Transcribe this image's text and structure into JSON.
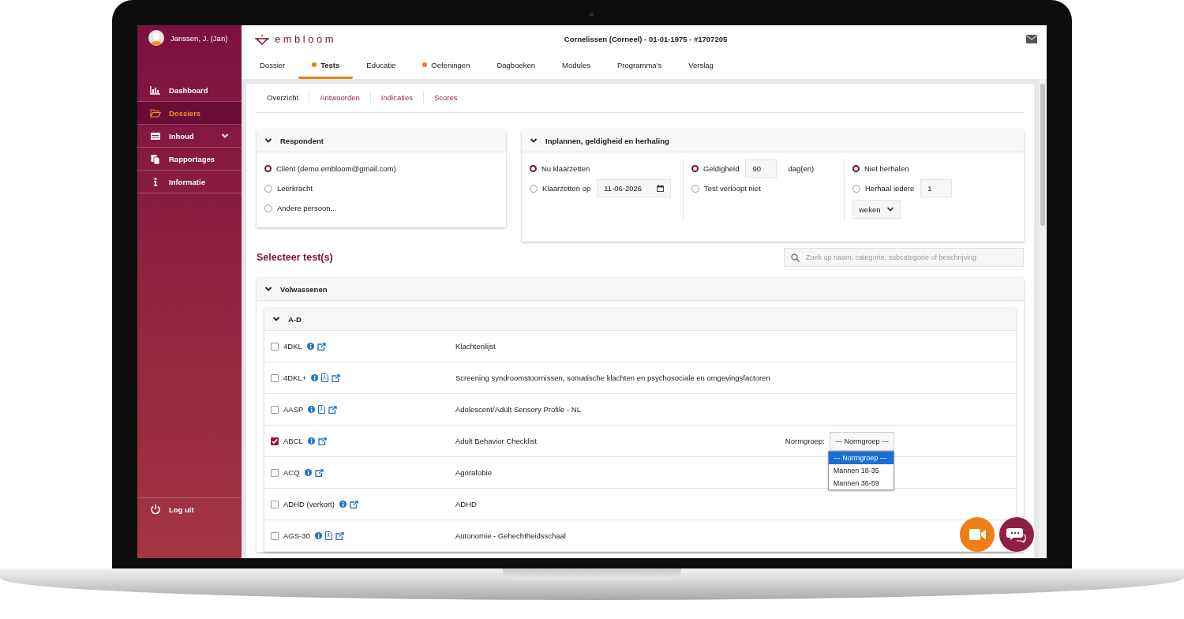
{
  "user": {
    "name": "Janssen, J. (Jan)"
  },
  "sidebar": {
    "items": [
      {
        "label": "Dashboard",
        "kind": "link",
        "selected": false
      },
      {
        "label": "Dossiers",
        "kind": "link",
        "selected": true
      },
      {
        "label": "Inhoud",
        "kind": "group",
        "selected": false
      },
      {
        "label": "Rapportages",
        "kind": "link",
        "selected": false
      },
      {
        "label": "Informatie",
        "kind": "link",
        "selected": false
      }
    ],
    "logout": "Log uit"
  },
  "header": {
    "logo": "embloom",
    "patient": "Cornelissen (Corneel) - 01-01-1975 - #1707205"
  },
  "tabs": [
    {
      "label": "Dossier",
      "selected": false,
      "dot": false
    },
    {
      "label": "Tests",
      "selected": true,
      "dot": true
    },
    {
      "label": "Educatie",
      "selected": false,
      "dot": false
    },
    {
      "label": "Oefeningen",
      "selected": false,
      "dot": true
    },
    {
      "label": "Dagboeken",
      "selected": false,
      "dot": false
    },
    {
      "label": "Modules",
      "selected": false,
      "dot": false
    },
    {
      "label": "Programma's",
      "selected": false,
      "dot": false
    },
    {
      "label": "Verslag",
      "selected": false,
      "dot": false
    }
  ],
  "subtabs": [
    {
      "label": "Overzicht",
      "selected": true
    },
    {
      "label": "Antwoorden",
      "selected": false
    },
    {
      "label": "Indicaties",
      "selected": false
    },
    {
      "label": "Scores",
      "selected": false
    }
  ],
  "respondent": {
    "title": "Respondent",
    "options": [
      {
        "label": "Cliënt (demo.embloom@gmail.com)",
        "selected": true
      },
      {
        "label": "Leerkracht",
        "selected": false
      },
      {
        "label": "Andere persoon...",
        "selected": false
      }
    ]
  },
  "schedule": {
    "title": "Inplannen, geldigheid en herhaling",
    "groups": [
      {
        "options": [
          {
            "label": "Nu klaarzetten",
            "selected": true
          },
          {
            "label": "Klaarzetten op",
            "selected": false,
            "field": {
              "kind": "date",
              "value": "11-06-2026"
            }
          }
        ]
      },
      {
        "options": [
          {
            "label": "Geldigheid",
            "selected": true,
            "field": {
              "kind": "number",
              "value": "90"
            },
            "suffix": "dag(en)"
          },
          {
            "label": "Test verloopt niet",
            "selected": false
          }
        ]
      },
      {
        "options": [
          {
            "label": "Niet herhalen",
            "selected": true
          },
          {
            "label": "Herhaal iedere",
            "selected": false,
            "field": {
              "kind": "number",
              "value": "1"
            }
          }
        ],
        "select": "weken"
      }
    ]
  },
  "tests_section": {
    "title": "Selecteer test(s)",
    "search": {
      "placeholder": "Zoek op naam, categorie, subcategorie of beschrijving"
    }
  },
  "category": {
    "title": "Volwassenen",
    "expanded": true,
    "subcategory": {
      "title": "A-D",
      "expanded": true,
      "tests": [
        {
          "code": "4DKL",
          "checked": false,
          "links": [
            {
              "kind": "info"
            },
            {
              "kind": "external"
            }
          ],
          "description": "Klachtenlijst"
        },
        {
          "code": "4DKL+",
          "checked": false,
          "links": [
            {
              "kind": "info"
            },
            {
              "kind": "pdf"
            },
            {
              "kind": "external"
            }
          ],
          "description": "Screening syndroomstoornissen, somatische klachten en psychosociale en omgevingsfactoren"
        },
        {
          "code": "AASP",
          "checked": false,
          "links": [
            {
              "kind": "info"
            },
            {
              "kind": "pdf"
            },
            {
              "kind": "external"
            }
          ],
          "description": "Adolescent/Adult Sensory Profile - NL"
        },
        {
          "code": "ABCL",
          "checked": true,
          "links": [
            {
              "kind": "info"
            },
            {
              "kind": "external"
            }
          ],
          "description": "Adult Behavior Checklist",
          "norm": {
            "label": "Normgroep:",
            "value": "--- Normgroep ---",
            "expanded": true,
            "options": [
              {
                "label": "--- Normgroep ---",
                "selected": true
              },
              {
                "label": "Mannen 18-35",
                "selected": false
              },
              {
                "label": "Mannen 36-59",
                "selected": false
              }
            ]
          }
        },
        {
          "code": "ACQ",
          "checked": false,
          "links": [
            {
              "kind": "info"
            },
            {
              "kind": "external"
            }
          ],
          "description": "Agorafobie"
        },
        {
          "code": "ADHD (verkort)",
          "checked": false,
          "links": [
            {
              "kind": "info"
            },
            {
              "kind": "external"
            }
          ],
          "description": "ADHD"
        },
        {
          "code": "AGS-30",
          "checked": false,
          "links": [
            {
              "kind": "info"
            },
            {
              "kind": "pdf"
            },
            {
              "kind": "external"
            }
          ],
          "description": "Autonomie - Gehechtheidsschaal"
        }
      ]
    }
  }
}
